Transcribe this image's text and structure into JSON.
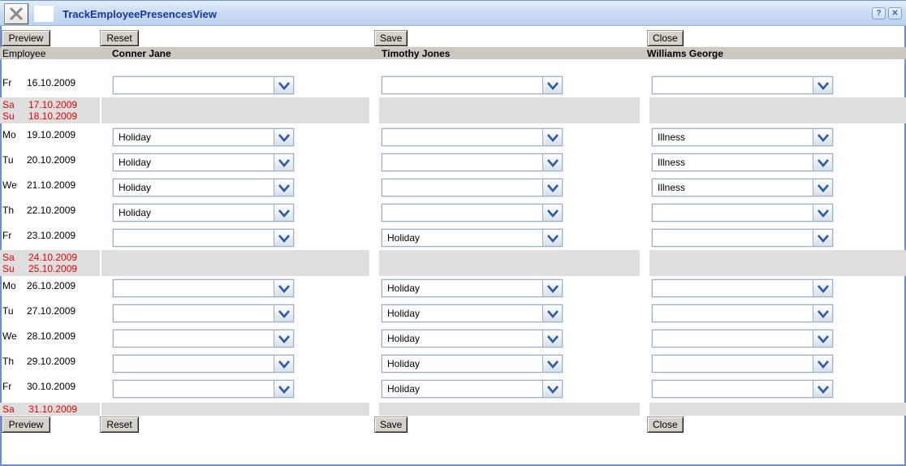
{
  "window": {
    "title": "TrackEmployeePresencesView",
    "help_label": "?",
    "close_glyph": "✕"
  },
  "toolbar": {
    "preview_label": "Preview",
    "reset_label": "Reset",
    "save_label": "Save",
    "close_label": "Close"
  },
  "table": {
    "employee_label": "Employee",
    "employees": [
      "Conner Jane",
      "Timothy Jones",
      "Williams George"
    ]
  },
  "colors": {
    "weekend_text": "#e60000",
    "weekend_band": "#dedede",
    "title_text": "#17379e",
    "combo_border": "#9ab0ca",
    "chevron": "#2d5aa8",
    "header_bg": "#cdc9c1"
  },
  "rows": [
    {
      "type": "day",
      "day": "Fr",
      "date": "16.10.2009",
      "values": [
        "",
        "",
        ""
      ]
    },
    {
      "type": "weekend",
      "lines": [
        {
          "day": "Sa",
          "date": "17.10.2009"
        },
        {
          "day": "Su",
          "date": "18.10.2009"
        }
      ]
    },
    {
      "type": "day",
      "day": "Mo",
      "date": "19.10.2009",
      "values": [
        "Holiday",
        "",
        "Illness"
      ]
    },
    {
      "type": "day",
      "day": "Tu",
      "date": "20.10.2009",
      "values": [
        "Holiday",
        "",
        "Illness"
      ]
    },
    {
      "type": "day",
      "day": "We",
      "date": "21.10.2009",
      "values": [
        "Holiday",
        "",
        "Illness"
      ]
    },
    {
      "type": "day",
      "day": "Th",
      "date": "22.10.2009",
      "values": [
        "Holiday",
        "",
        ""
      ]
    },
    {
      "type": "day",
      "day": "Fr",
      "date": "23.10.2009",
      "values": [
        "",
        "Holiday",
        ""
      ]
    },
    {
      "type": "weekend",
      "lines": [
        {
          "day": "Sa",
          "date": "24.10.2009"
        },
        {
          "day": "Su",
          "date": "25.10.2009"
        }
      ]
    },
    {
      "type": "day",
      "day": "Mo",
      "date": "26.10.2009",
      "values": [
        "",
        "Holiday",
        ""
      ]
    },
    {
      "type": "day",
      "day": "Tu",
      "date": "27.10.2009",
      "values": [
        "",
        "Holiday",
        ""
      ]
    },
    {
      "type": "day",
      "day": "We",
      "date": "28.10.2009",
      "values": [
        "",
        "Holiday",
        ""
      ]
    },
    {
      "type": "day",
      "day": "Th",
      "date": "29.10.2009",
      "values": [
        "",
        "Holiday",
        ""
      ]
    },
    {
      "type": "day",
      "day": "Fr",
      "date": "30.10.2009",
      "values": [
        "",
        "Holiday",
        ""
      ]
    },
    {
      "type": "weekend",
      "lines": [
        {
          "day": "Sa",
          "date": "31.10.2009"
        }
      ]
    }
  ]
}
